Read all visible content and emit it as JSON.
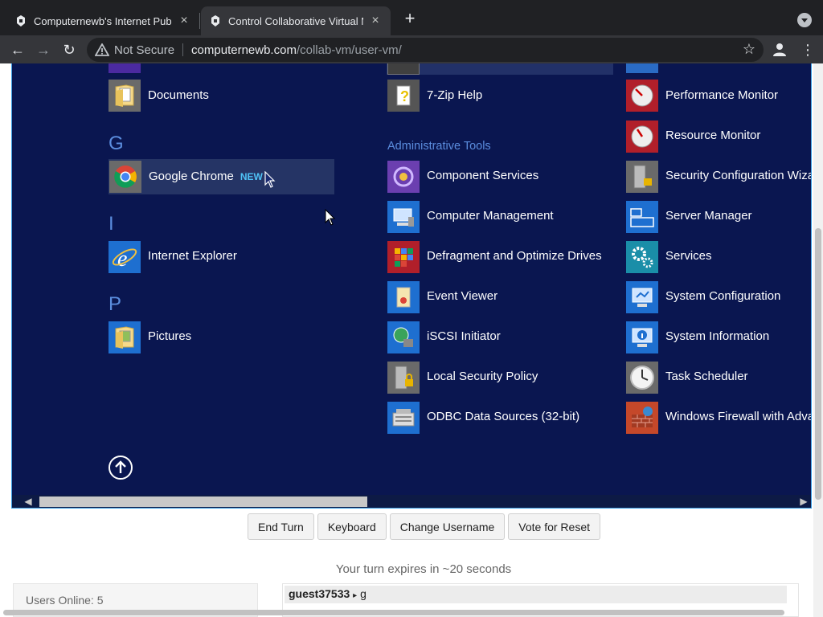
{
  "browser": {
    "tabs": [
      {
        "title": "Computernewb's Internet Pub",
        "active": false
      },
      {
        "title": "Control Collaborative Virtual M",
        "active": true
      }
    ],
    "omnibox": {
      "security": "Not Secure",
      "host": "computernewb.com",
      "path": "/collab-vm/user-vm/"
    },
    "new_tab_glyph": "+",
    "close_glyph": "×"
  },
  "vm": {
    "left_column": {
      "top_item": {
        "label": "Documents",
        "icon": "folder-icon"
      },
      "sections": [
        {
          "letter": "G",
          "items": [
            {
              "label": "Google Chrome",
              "badge": "NEW",
              "icon": "chrome-icon"
            }
          ]
        },
        {
          "letter": "I",
          "items": [
            {
              "label": "Internet Explorer",
              "icon": "ie-icon"
            }
          ]
        },
        {
          "letter": "P",
          "items": [
            {
              "label": "Pictures",
              "icon": "folder-icon"
            }
          ]
        }
      ]
    },
    "middle_column": {
      "top_item": {
        "label": "7-Zip Help",
        "icon": "help-file-icon"
      },
      "group_title": "Administrative Tools",
      "items": [
        {
          "label": "Component Services",
          "icon": "component-services-icon"
        },
        {
          "label": "Computer Management",
          "icon": "computer-management-icon"
        },
        {
          "label": "Defragment and Optimize Drives",
          "icon": "defragment-icon"
        },
        {
          "label": "Event Viewer",
          "icon": "event-viewer-icon"
        },
        {
          "label": "iSCSI Initiator",
          "icon": "iscsi-icon"
        },
        {
          "label": "Local Security Policy",
          "icon": "security-policy-icon"
        },
        {
          "label": "ODBC Data Sources (32-bit)",
          "icon": "odbc-icon"
        }
      ]
    },
    "right_column": {
      "items": [
        {
          "label": "Performance Monitor",
          "icon": "performance-monitor-icon"
        },
        {
          "label": "Resource Monitor",
          "icon": "resource-monitor-icon"
        },
        {
          "label": "Security Configuration Wizard",
          "icon": "security-wizard-icon"
        },
        {
          "label": "Server Manager",
          "icon": "server-manager-icon"
        },
        {
          "label": "Services",
          "icon": "services-gear-icon"
        },
        {
          "label": "System Configuration",
          "icon": "system-configuration-icon"
        },
        {
          "label": "System Information",
          "icon": "system-information-icon"
        },
        {
          "label": "Task Scheduler",
          "icon": "task-scheduler-icon"
        },
        {
          "label": "Windows Firewall with Advanced Security",
          "icon": "firewall-icon"
        }
      ]
    }
  },
  "controls": {
    "buttons": [
      "End Turn",
      "Keyboard",
      "Change Username",
      "Vote for Reset"
    ],
    "turn_status": "Your turn expires in ~20 seconds",
    "users_online": "Users Online: 5",
    "chat": [
      {
        "user": "guest37533",
        "sep": "▸",
        "message": "g"
      }
    ]
  },
  "colors": {
    "vm_background": "#0a1650",
    "group_text": "#5b8dde",
    "new_badge": "#4fc3f7",
    "chrome_dark": "#202124"
  }
}
